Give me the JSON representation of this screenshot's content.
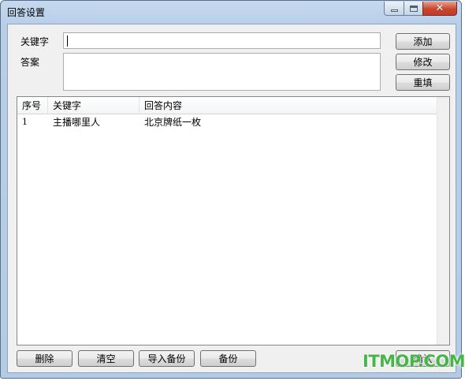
{
  "window": {
    "title": "回答设置"
  },
  "form": {
    "keyword_label": "关键字",
    "keyword_value": "",
    "answer_label": "答案",
    "answer_value": ""
  },
  "side_buttons": {
    "add": "添加",
    "edit": "修改",
    "reset": "重填"
  },
  "table": {
    "columns": [
      "序号",
      "关键字",
      "回答内容"
    ],
    "rows": [
      {
        "num": "1",
        "keyword": "主播哪里人",
        "answer": "北京牌纸一枚"
      }
    ]
  },
  "bottom_buttons": {
    "delete": "删除",
    "clear": "清空",
    "import_backup": "导入备份",
    "backup": "备份",
    "ok": "确认"
  },
  "watermark": {
    "text": "ITMOP.COM",
    "color": "#47b64a"
  }
}
